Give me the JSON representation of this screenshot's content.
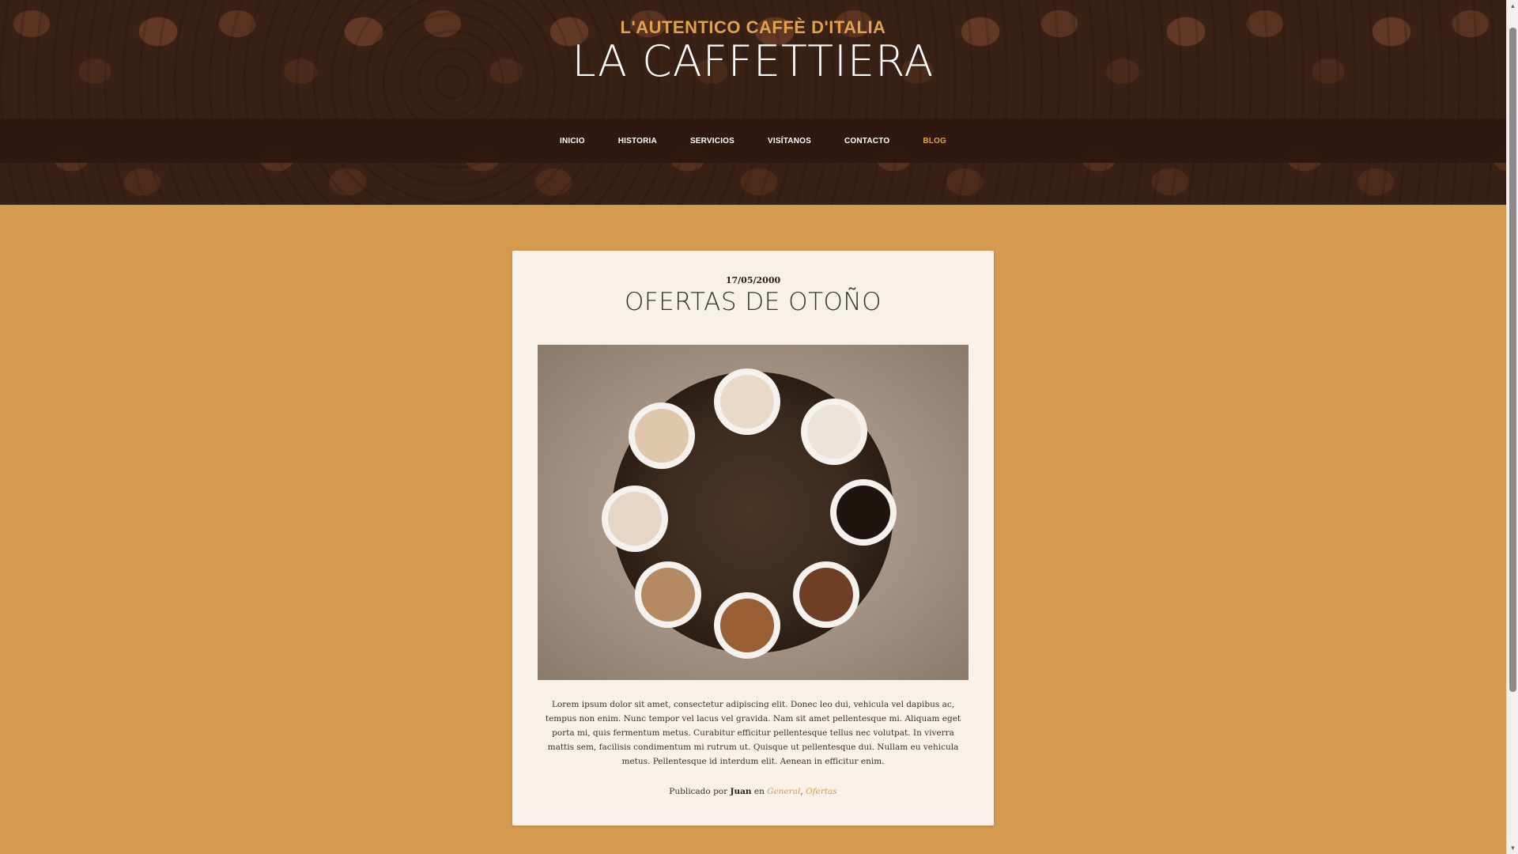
{
  "header": {
    "tagline": "L'AUTENTICO CAFFÈ D'ITALIA",
    "title": "LA CAFFETTIERA"
  },
  "nav": {
    "items": [
      {
        "label": "INICIO",
        "active": false
      },
      {
        "label": "HISTORIA",
        "active": false
      },
      {
        "label": "SERVICIOS",
        "active": false
      },
      {
        "label": "VISÍTANOS",
        "active": false
      },
      {
        "label": "CONTACTO",
        "active": false
      },
      {
        "label": "BLOG",
        "active": true
      }
    ]
  },
  "post": {
    "date": "17/05/2000",
    "title": "OFERTAS DE OTOÑO",
    "body": "Lorem ipsum dolor sit amet, consectetur adipiscing elit. Donec leo dui, vehicula vel dapibus ac, tempus non enim. Nunc tempor vel lacus vel gravida. Nam sit amet pellentesque mi. Aliquam eget porta mi, quis fermentum metus. Curabitur efficitur pellentesque tellus nec volutpat. In viverra mattis sem, facilisis condimentum mi rutrum ut. Quisque ut pellentesque dui. Nullam eu vehicula metus. Pellentesque id interdum elit. Aenean in efficitur enim.",
    "meta_prefix": "Publicado por",
    "author": "Juan",
    "meta_in": "en",
    "categories": [
      "General",
      "Ofertas"
    ],
    "category_separator": ","
  },
  "colors": {
    "accent": "#e0a24a",
    "background": "#d49a4e",
    "card": "#f8f1ea",
    "nav_bar": "#2d1810"
  },
  "icons": {
    "scroll_up": "chevron-up-icon",
    "scroll_down": "chevron-down-icon"
  }
}
